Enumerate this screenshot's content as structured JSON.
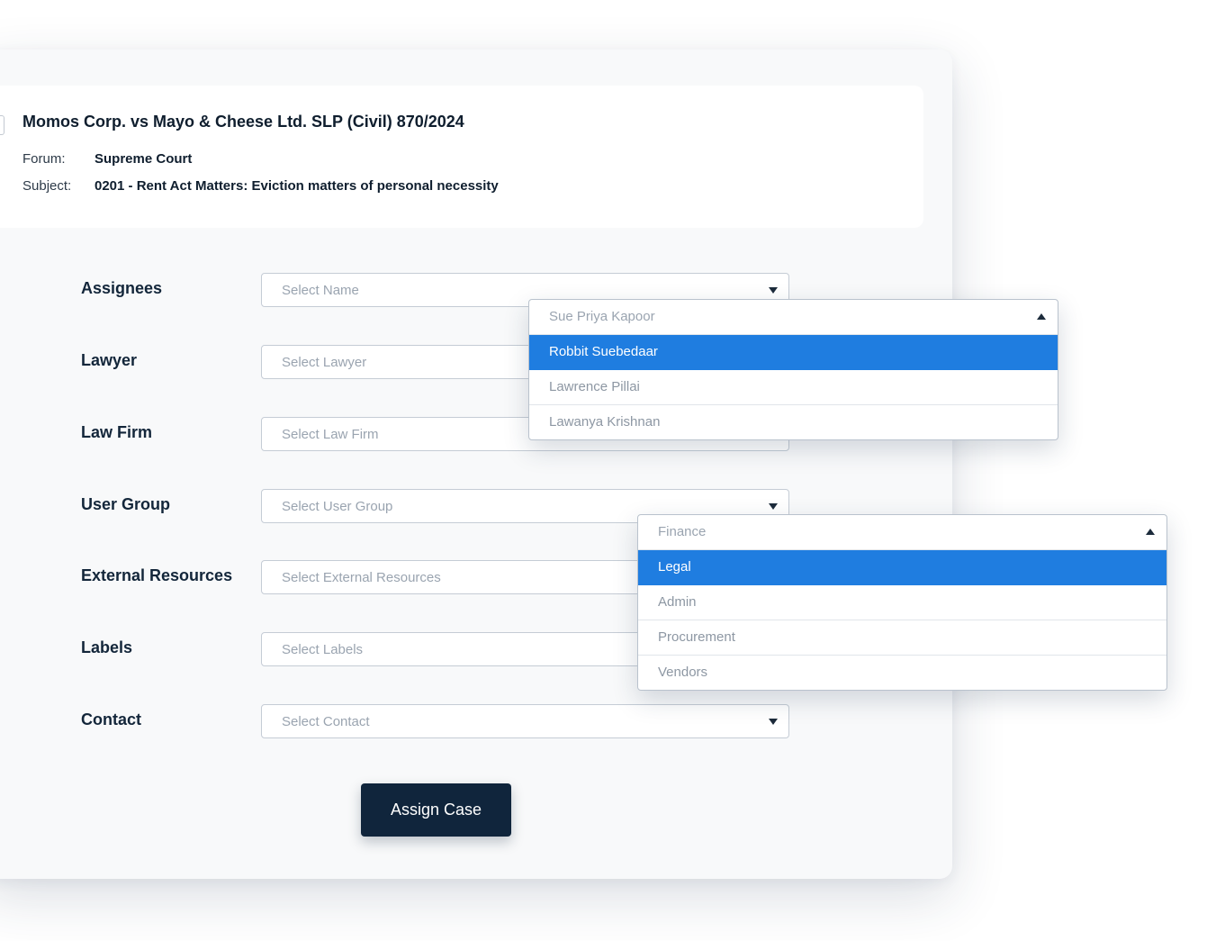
{
  "case": {
    "title": "Momos Corp. vs Mayo & Cheese Ltd. SLP (Civil) 870/2024",
    "forum_label": "Forum:",
    "forum_value": "Supreme Court",
    "subject_label": "Subject:",
    "subject_value": "0201 - Rent Act Matters: Eviction matters of personal necessity"
  },
  "form": {
    "assignees": {
      "label": "Assignees",
      "placeholder": "Select Name"
    },
    "lawyer": {
      "label": "Lawyer",
      "placeholder": "Select Lawyer"
    },
    "law_firm": {
      "label": "Law Firm",
      "placeholder": "Select Law Firm"
    },
    "user_group": {
      "label": "User Group",
      "placeholder": "Select User Group"
    },
    "external_resources": {
      "label": "External Resources",
      "placeholder": "Select External Resources"
    },
    "labels": {
      "label": "Labels",
      "placeholder": "Select Labels"
    },
    "contact": {
      "label": "Contact",
      "placeholder": "Select Contact"
    }
  },
  "name_dropdown": {
    "head": "Sue Priya Kapoor",
    "options": [
      "Robbit Suebedaar",
      "Lawrence Pillai",
      "Lawanya Krishnan"
    ],
    "selected_index": 0
  },
  "group_dropdown": {
    "head": "Finance",
    "options": [
      "Legal",
      "Admin",
      "Procurement",
      "Vendors"
    ],
    "selected_index": 0
  },
  "assign_button": {
    "label": "Assign Case"
  },
  "colors": {
    "accent": "#1f7de0",
    "button_bg": "#10253c",
    "panel_bg": "#f8f9fa"
  }
}
